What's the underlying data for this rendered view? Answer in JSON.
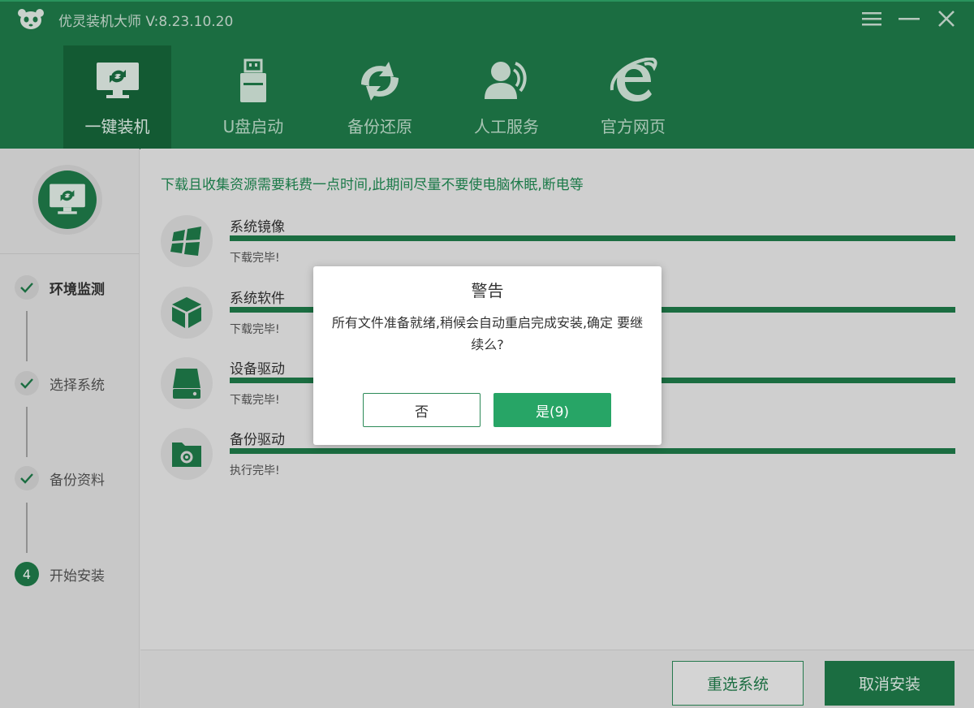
{
  "app": {
    "title": "优灵装机大师 V:8.23.10.20",
    "accent_color": "#1f7d4b",
    "icons": {
      "logo": "panda-logo-icon",
      "menu": "menu-icon",
      "minimize": "minimize-icon",
      "close": "close-icon"
    }
  },
  "nav": {
    "items": [
      {
        "label": "一键装机",
        "icon": "monitor-refresh-icon",
        "active": true
      },
      {
        "label": "U盘启动",
        "icon": "usb-drive-icon",
        "active": false
      },
      {
        "label": "备份还原",
        "icon": "sync-arrows-icon",
        "active": false
      },
      {
        "label": "人工服务",
        "icon": "support-agent-icon",
        "active": false
      },
      {
        "label": "官方网页",
        "icon": "browser-e-icon",
        "active": false
      }
    ]
  },
  "sidebar": {
    "hero_icon": "monitor-refresh-icon",
    "steps": [
      {
        "label": "环境监测",
        "state": "done",
        "icon": "check-icon"
      },
      {
        "label": "选择系统",
        "state": "done",
        "icon": "check-icon"
      },
      {
        "label": "备份资料",
        "state": "done",
        "icon": "check-icon"
      },
      {
        "label": "开始安装",
        "state": "current",
        "number": "4"
      }
    ]
  },
  "main": {
    "notice": "下载且收集资源需要耗费一点时间,此期间尽量不要使电脑休眠,断电等",
    "tasks": [
      {
        "name": "系统镜像",
        "status": "下载完毕!",
        "progress": 1.0,
        "icon": "windows-logo-icon"
      },
      {
        "name": "系统软件",
        "status": "下载完毕!",
        "progress": 1.0,
        "icon": "package-box-icon"
      },
      {
        "name": "设备驱动",
        "status": "下载完毕!",
        "progress": 1.0,
        "icon": "hard-drive-icon"
      },
      {
        "name": "备份驱动",
        "status": "执行完毕!",
        "progress": 1.0,
        "icon": "folder-gear-icon"
      }
    ]
  },
  "footer": {
    "reselect_label": "重选系统",
    "cancel_label": "取消安装"
  },
  "dialog": {
    "title": "警告",
    "message": "所有文件准备就绪,稍候会自动重启完成安装,确定 要继续么?",
    "no_label": "否",
    "yes_label": "是(9)"
  }
}
